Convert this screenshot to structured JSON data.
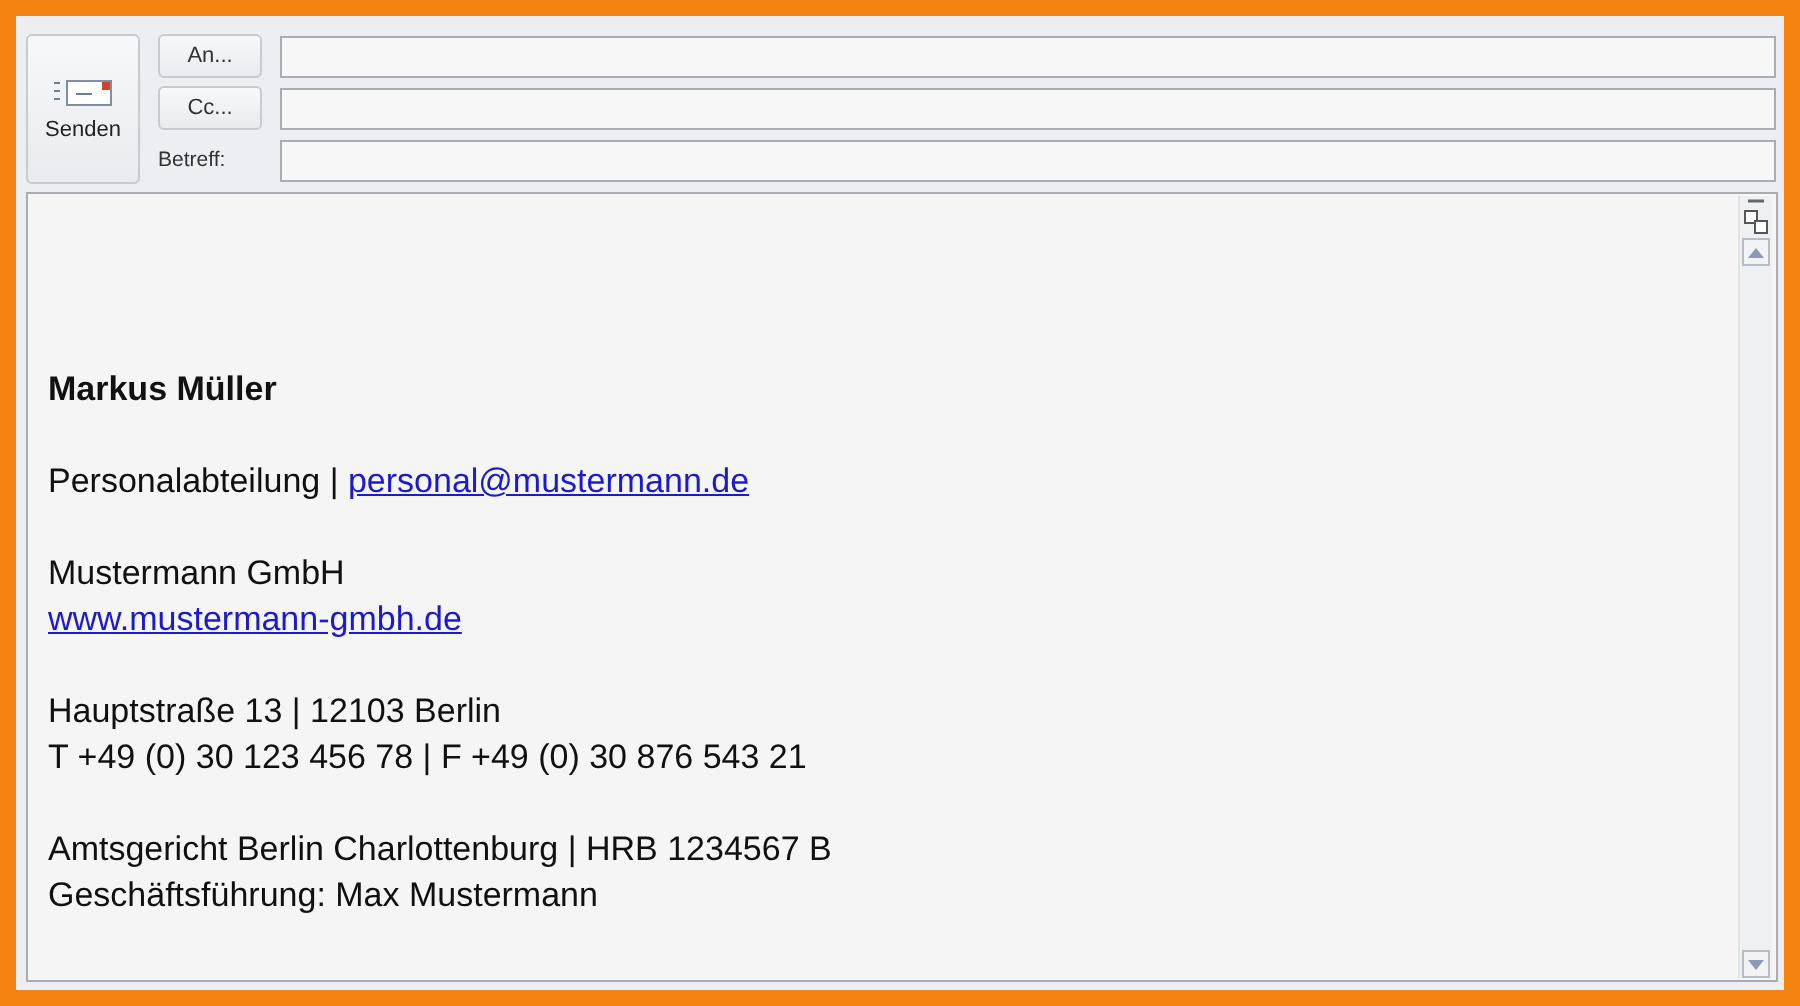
{
  "send_button": {
    "label": "Senden"
  },
  "fields": [
    {
      "kind": "button",
      "label": "An..."
    },
    {
      "kind": "button",
      "label": "Cc..."
    },
    {
      "kind": "label",
      "label": "Betreff:"
    }
  ],
  "body": {
    "blocks": [
      [
        {
          "bold": true,
          "parts": [
            {
              "text": "Markus Müller",
              "link": false
            }
          ]
        }
      ],
      [
        {
          "bold": false,
          "parts": [
            {
              "text": "Personalabteilung | ",
              "link": false
            },
            {
              "text": "personal@mustermann.de",
              "link": true
            }
          ]
        }
      ],
      [
        {
          "bold": false,
          "parts": [
            {
              "text": "Mustermann GmbH",
              "link": false
            }
          ]
        },
        {
          "bold": false,
          "parts": [
            {
              "text": "www.mustermann-gmbh.de",
              "link": true
            }
          ]
        }
      ],
      [
        {
          "bold": false,
          "parts": [
            {
              "text": "Hauptstraße 13 | 12103 Berlin",
              "link": false
            }
          ]
        },
        {
          "bold": false,
          "parts": [
            {
              "text": "T +49 (0) 30 123 456 78 | F +49 (0) 30 876 543 21",
              "link": false
            }
          ]
        }
      ],
      [
        {
          "bold": false,
          "parts": [
            {
              "text": "Amtsgericht Berlin Charlottenburg | HRB 1234567 B",
              "link": false
            }
          ]
        },
        {
          "bold": false,
          "parts": [
            {
              "text": "Geschäftsführung: Max Mustermann",
              "link": false
            }
          ]
        }
      ]
    ]
  }
}
